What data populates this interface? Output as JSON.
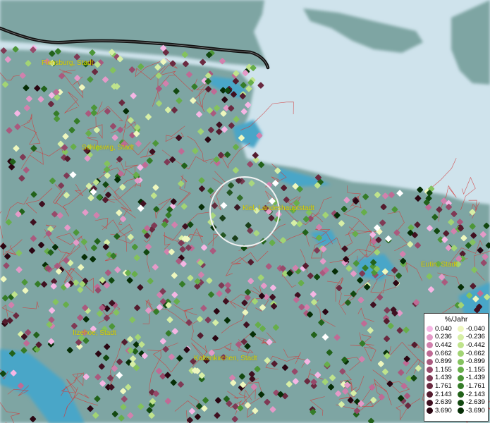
{
  "map": {
    "cities": [
      {
        "key": "flensburg",
        "label": "Flensburg, Stadt"
      },
      {
        "key": "schleswig",
        "label": "Schleswig, Stadt"
      },
      {
        "key": "kiel",
        "label": "Kiel, Landeshauptstadt"
      },
      {
        "key": "eutin",
        "label": "Eutin, Stadt"
      },
      {
        "key": "itzehoe",
        "label": "Itzehoe, Stadt"
      },
      {
        "key": "kaltenkirchen",
        "label": "Kaltenkirchen, Stadt"
      }
    ],
    "colors": {
      "sea": "#cfe3ec",
      "land": "#7ea5a3",
      "water": "#4aa6c8",
      "boundary": "#d23a3a",
      "label": "#d8d000"
    }
  },
  "legend": {
    "title": "%/Jahr",
    "positive": [
      "0.040",
      "0.236",
      "0.442",
      "0.662",
      "0.899",
      "1.155",
      "1.439",
      "1.761",
      "2.143",
      "2.639",
      "3.690"
    ],
    "negative": [
      "-0.040",
      "-0.236",
      "-0.442",
      "-0.662",
      "-0.899",
      "-1.155",
      "-1.439",
      "-1.761",
      "-2.143",
      "-2.639",
      "-3.690"
    ],
    "positive_colors": [
      "#f5b6e4",
      "#e49ac8",
      "#d181ad",
      "#bf6b95",
      "#aa5a7e",
      "#964a6a",
      "#7f3a55",
      "#6a2a40",
      "#541c2e",
      "#3f1020",
      "#2a0612"
    ],
    "negative_colors": [
      "#eef7be",
      "#d7efa6",
      "#bfe38c",
      "#a2d474",
      "#84c25e",
      "#67ae4a",
      "#4c9638",
      "#357c28",
      "#22621a",
      "#124810",
      "#062e06"
    ]
  }
}
